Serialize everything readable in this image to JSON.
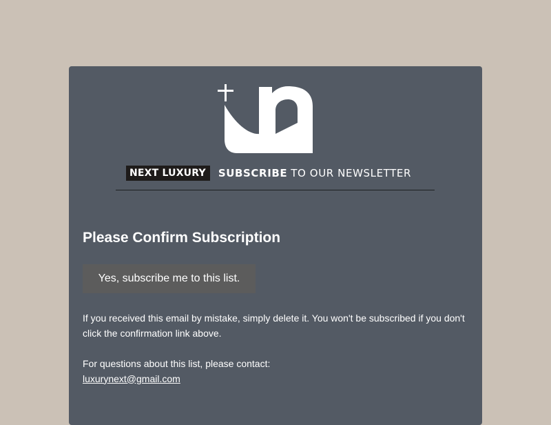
{
  "brand": {
    "badge": "NEXT LUXURY",
    "tagline_strong": "SUBSCRIBE",
    "tagline_light": "TO OUR NEWSLETTER"
  },
  "main": {
    "title": "Please Confirm Subscription",
    "confirm_button": "Yes, subscribe me to this list.",
    "mistake_text": "If you received this email by mistake, simply delete it. You won't be subscribed if you don't click the confirmation link above.",
    "contact_text": "For questions about this list, please contact:",
    "contact_email": "luxurynext@gmail.com"
  },
  "colors": {
    "page_background": "#cbc1b6",
    "card_background": "#535a64",
    "button_background": "#5c5c5c",
    "badge_background": "#1e1b1a",
    "text": "#ffffff"
  },
  "icons": {
    "logo": "next-luxury-logo-icon"
  }
}
